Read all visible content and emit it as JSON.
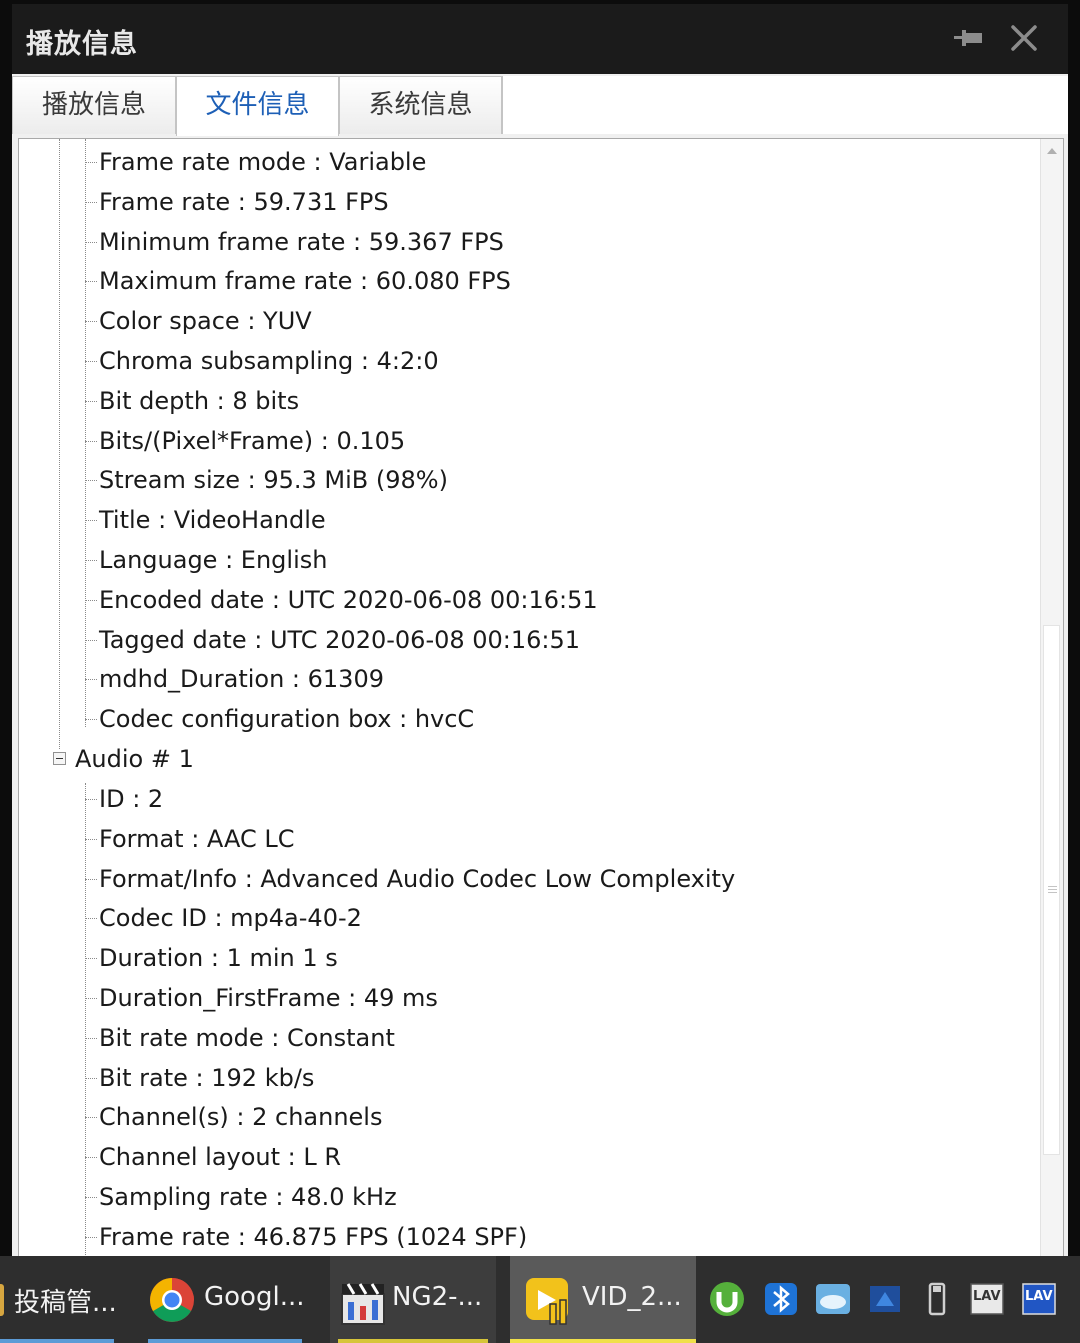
{
  "window": {
    "title": "播放信息"
  },
  "tabs": [
    {
      "label": "播放信息",
      "active": false
    },
    {
      "label": "文件信息",
      "active": true
    },
    {
      "label": "系统信息",
      "active": false
    }
  ],
  "video_items": [
    "Frame rate mode : Variable",
    "Frame rate : 59.731 FPS",
    "Minimum frame rate : 59.367 FPS",
    "Maximum frame rate : 60.080 FPS",
    "Color space : YUV",
    "Chroma subsampling : 4:2:0",
    "Bit depth : 8 bits",
    "Bits/(Pixel*Frame) : 0.105",
    "Stream size : 95.3 MiB (98%)",
    "Title : VideoHandle",
    "Language : English",
    "Encoded date : UTC 2020-06-08 00:16:51",
    "Tagged date : UTC 2020-06-08 00:16:51",
    "mdhd_Duration : 61309",
    "Codec configuration box : hvcC"
  ],
  "audio_section": {
    "label": "Audio # 1"
  },
  "audio_items": [
    "ID : 2",
    "Format : AAC LC",
    "Format/Info : Advanced Audio Codec Low Complexity",
    "Codec ID : mp4a-40-2",
    "Duration : 1 min 1 s",
    "Duration_FirstFrame : 49 ms",
    "Bit rate mode : Constant",
    "Bit rate : 192 kb/s",
    "Channel(s) : 2 channels",
    "Channel layout : L R",
    "Sampling rate : 48.0 kHz",
    "Frame rate : 46.875 FPS (1024 SPF)"
  ],
  "taskbar": {
    "items": [
      {
        "label": "投稿管...",
        "icon": "pen-icon"
      },
      {
        "label": "Googl...",
        "icon": "chrome-icon"
      },
      {
        "label": "NG2-...",
        "icon": "clapper-icon"
      },
      {
        "label": "VID_2...",
        "icon": "video-editor-icon"
      }
    ],
    "tray": [
      "utorrent-icon",
      "bluetooth-icon",
      "cloud-icon",
      "network-icon",
      "usb-drive-icon",
      "lav-audio-icon",
      "lav-video-icon"
    ],
    "tray_labels": {
      "lav": "LAV"
    }
  },
  "colors": {
    "accent": "#1d5fb6",
    "titlebar": "#1b1b1b",
    "taskbar": "#2e2e2e"
  }
}
